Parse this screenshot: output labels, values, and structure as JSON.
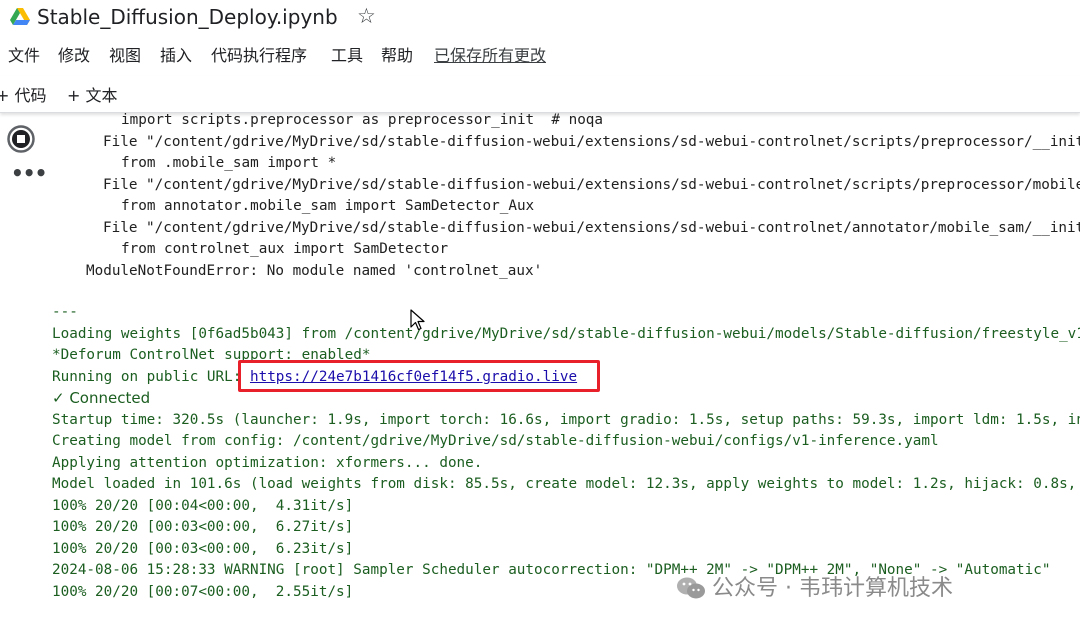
{
  "window": {
    "title": "Stable_Diffusion_Deploy.ipynb",
    "star_icon": "star-outline-icon"
  },
  "menu": {
    "items": [
      "文件",
      "修改",
      "视图",
      "插入",
      "代码执行程序",
      "工具",
      "帮助"
    ],
    "saved_status": "已保存所有更改"
  },
  "toolbar": {
    "add_code": "+ 代码",
    "add_text": "+ 文本"
  },
  "output": {
    "trace_lines": [
      "import scripts.preprocessor as preprocessor_init  # noqa",
      "File \"/content/gdrive/MyDrive/sd/stable-diffusion-webui/extensions/sd-webui-controlnet/scripts/preprocessor/__init",
      "from .mobile_sam import *",
      "File \"/content/gdrive/MyDrive/sd/stable-diffusion-webui/extensions/sd-webui-controlnet/scripts/preprocessor/mobile",
      "from annotator.mobile_sam import SamDetector_Aux",
      "File \"/content/gdrive/MyDrive/sd/stable-diffusion-webui/extensions/sd-webui-controlnet/annotator/mobile_sam/__init",
      "from controlnet_aux import SamDetector",
      "ModuleNotFoundError: No module named 'controlnet_aux'"
    ],
    "separator": "---",
    "loading_weights": "Loading weights [0f6ad5b043] from /content/gdrive/MyDrive/sd/stable-diffusion-webui/models/Stable-diffusion/freestyle_v1",
    "deforum": "*Deforum ControlNet support: enabled*",
    "running_label": "Running on public URL: ",
    "public_url": "https://24e7b1416cf0ef14f5.gradio.live",
    "connected": "✓ Connected",
    "log_lines": [
      "Startup time: 320.5s (launcher: 1.9s, import torch: 16.6s, import gradio: 1.5s, setup paths: 59.3s, import ldm: 1.5s, in",
      "Creating model from config: /content/gdrive/MyDrive/sd/stable-diffusion-webui/configs/v1-inference.yaml",
      "Applying attention optimization: xformers... done.",
      "Model loaded in 101.6s (load weights from disk: 85.5s, create model: 12.3s, apply weights to model: 1.2s, hijack: 0.8s, l",
      "100% 20/20 [00:04<00:00,  4.31it/s]",
      "100% 20/20 [00:03<00:00,  6.27it/s]",
      "100% 20/20 [00:03<00:00,  6.23it/s]",
      "2024-08-06 15:28:33 WARNING [root] Sampler Scheduler autocorrection: \"DPM++ 2M\" -> \"DPM++ 2M\", \"None\" -> \"Automatic\"",
      "100% 20/20 [00:07<00:00,  2.55it/s]"
    ]
  },
  "watermark": {
    "text": "公众号 · 韦玮计算机技术"
  },
  "colors": {
    "output_green": "#1b5e20",
    "highlight_red": "#e8202a",
    "link_blue": "#1a0dab"
  }
}
